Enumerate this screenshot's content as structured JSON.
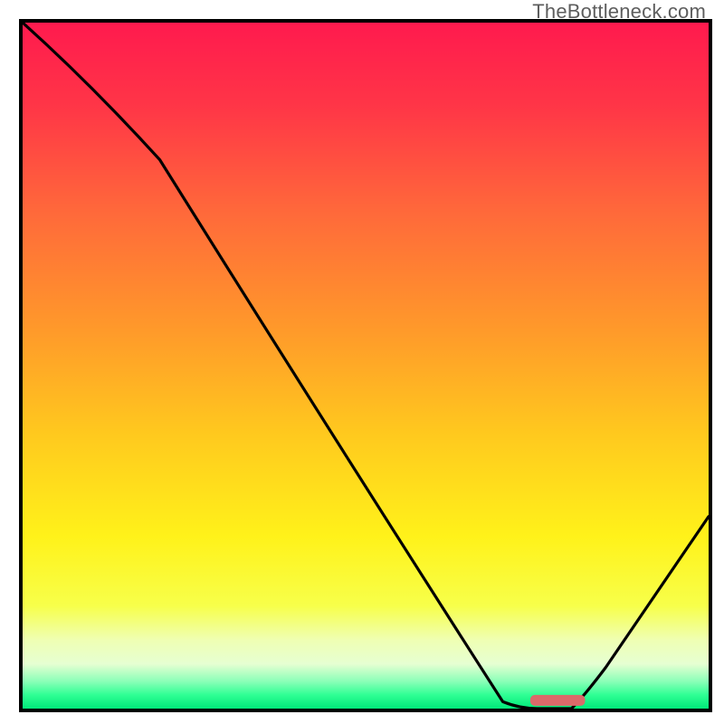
{
  "watermark": "TheBottleneck.com",
  "chart_data": {
    "type": "line",
    "title": "",
    "xlabel": "",
    "ylabel": "",
    "xlim": [
      0,
      100
    ],
    "ylim": [
      0,
      100
    ],
    "grid": false,
    "legend": false,
    "series": [
      {
        "name": "bottleneck-curve",
        "x": [
          0,
          20,
          70,
          75,
          80,
          100
        ],
        "y": [
          100,
          80,
          1,
          0,
          0,
          28
        ]
      }
    ],
    "marker": {
      "name": "optimal-zone",
      "x_start": 74,
      "x_end": 82,
      "y": 1.2,
      "color": "#da6a6a"
    },
    "background": {
      "type": "vertical-gradient",
      "stops": [
        {
          "pct": 0,
          "color": "#ff1a4e"
        },
        {
          "pct": 12,
          "color": "#ff3547"
        },
        {
          "pct": 28,
          "color": "#ff6a3a"
        },
        {
          "pct": 45,
          "color": "#ff9a2a"
        },
        {
          "pct": 60,
          "color": "#ffc91e"
        },
        {
          "pct": 75,
          "color": "#fff21a"
        },
        {
          "pct": 85,
          "color": "#f7ff4a"
        },
        {
          "pct": 90,
          "color": "#efffb3"
        },
        {
          "pct": 93.5,
          "color": "#e6ffd2"
        },
        {
          "pct": 96,
          "color": "#8cffb8"
        },
        {
          "pct": 98,
          "color": "#2fff94"
        },
        {
          "pct": 100,
          "color": "#00e879"
        }
      ]
    }
  }
}
